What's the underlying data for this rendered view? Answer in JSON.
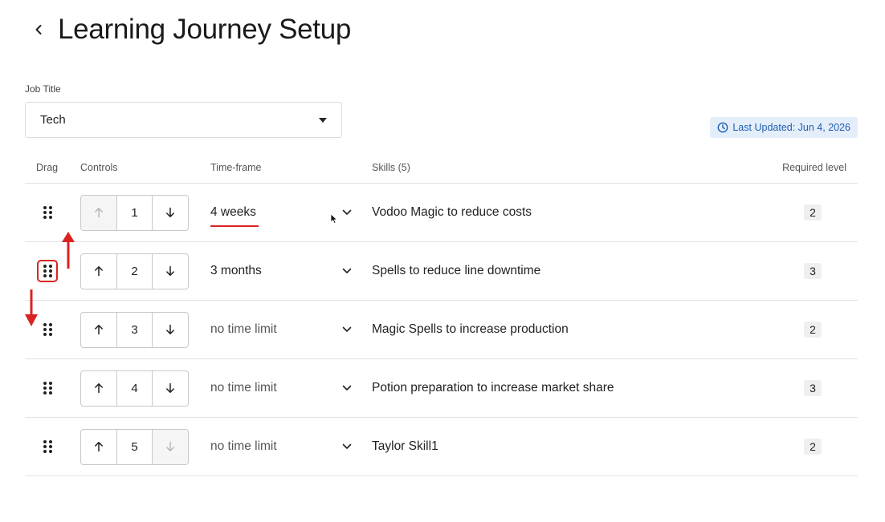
{
  "header": {
    "title": "Learning Journey Setup"
  },
  "job": {
    "label": "Job Title",
    "value": "Tech"
  },
  "badge": {
    "text": "Last Updated: Jun 4, 2026"
  },
  "columns": {
    "drag": "Drag",
    "controls": "Controls",
    "timeframe": "Time-frame",
    "skills": "Skills (5)",
    "level": "Required level"
  },
  "rows": [
    {
      "order": "1",
      "timeframe": "4 weeks",
      "skill": "Vodoo Magic to reduce costs",
      "level": "2"
    },
    {
      "order": "2",
      "timeframe": "3 months",
      "skill": "Spells to reduce line downtime",
      "level": "3"
    },
    {
      "order": "3",
      "timeframe": "no time limit",
      "skill": "Magic Spells to increase production",
      "level": "2"
    },
    {
      "order": "4",
      "timeframe": "no time limit",
      "skill": "Potion preparation to increase market share",
      "level": "3"
    },
    {
      "order": "5",
      "timeframe": "no time limit",
      "skill": "Taylor Skill1",
      "level": "2"
    }
  ],
  "icons": {
    "back": "chevron-left-icon",
    "select_caret": "caret-down-icon",
    "clock": "clock-icon",
    "drag": "drag-dots-icon",
    "up": "arrow-up-icon",
    "down": "arrow-down-icon",
    "expand": "chevron-down-icon"
  },
  "colors": {
    "accent_red": "#d92323",
    "badge_bg": "#e4eefb",
    "badge_text": "#1f5fae"
  }
}
